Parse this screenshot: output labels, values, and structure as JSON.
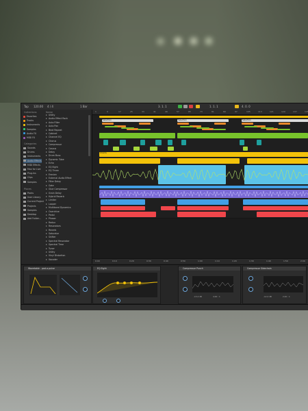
{
  "toolbar": {
    "tap_label": "Tap",
    "tempo": "120.00",
    "time_sig": "4 / 4",
    "bar_label": "1 Bar",
    "position": "3. 1. 1",
    "loop_start": "1. 1. 1",
    "loop_len": "4. 0. 0"
  },
  "browser": {
    "collections_header": "Collections",
    "names_header": "Name",
    "collections": [
      {
        "label": "Favorites",
        "color": "#e84b3c"
      },
      {
        "label": "Tracks",
        "color": "#f39c12"
      },
      {
        "label": "Instruments",
        "color": "#f1c40f"
      },
      {
        "label": "Samples",
        "color": "#2ecc71"
      },
      {
        "label": "Audio FX",
        "color": "#3498db"
      },
      {
        "label": "MIDI FX",
        "color": "#9b59b6"
      }
    ],
    "categories_header": "Categories",
    "categories": [
      "Sounds",
      "Drums",
      "Instruments",
      "Audio Effects",
      "MIDI Effects",
      "Max for Live",
      "Plug-Ins",
      "Clips",
      "Samples"
    ],
    "places_header": "Places",
    "places": [
      "Packs",
      "User Library",
      "Current Project",
      "Projects",
      "Samples",
      "Desktop",
      "Add Folder..."
    ],
    "names": [
      "Utility",
      "Audio Effect Rack",
      "Auto Filter",
      "Auto Pan",
      "Beat Repeat",
      "Cabinet",
      "Channel EQ",
      "Chorus",
      "Compressor",
      "Corpus",
      "Delay",
      "Drum Buss",
      "Dynamic Tube",
      "Echo",
      "EQ Eight",
      "EQ Three",
      "Erosion",
      "External Audio Effect",
      "Filter Delay",
      "Gate",
      "Glue Compressor",
      "Grain Delay",
      "Hybrid Reverb",
      "Limiter",
      "Looper",
      "Multiband Dynamics",
      "Overdrive",
      "Pedal",
      "Phaser",
      "Redux",
      "Resonators",
      "Reverb",
      "Saturator",
      "Shifter",
      "Spectral Resonator",
      "Spectral Time",
      "Tuner",
      "Utility",
      "Vinyl Distortion",
      "Vocoder"
    ]
  },
  "arrangement": {
    "ruler_marks": [
      "1",
      "9",
      "17",
      "25",
      "33",
      "41",
      "49",
      "57",
      "65",
      "73",
      "81",
      "89",
      "97",
      "105",
      "113",
      "121",
      "129",
      "137",
      "145"
    ],
    "time_marks": [
      "0:00",
      "0:10",
      "0:20",
      "0:30",
      "0:40",
      "0:50",
      "1:00",
      "1:10",
      "1:20",
      "1:30",
      "1:40",
      "1:50",
      "2:00"
    ],
    "group_label": "Selection",
    "clip_label": "Chords",
    "colors": {
      "yellow": "#f3c20a",
      "orange": "#e9892a",
      "green": "#78c32b",
      "teal": "#1e9f9d",
      "lightgreen": "#a6d63c",
      "blue": "#42a0e6",
      "cyan": "#5cc3e8",
      "red": "#f0464b",
      "purple": "#7b6bd6"
    }
  },
  "devices": {
    "items": [
      {
        "title": "Wavetable - pad-a-pulse",
        "color": "#f3c20a"
      },
      {
        "title": "EQ Eight",
        "color": "#f3c20a"
      },
      {
        "title": "Compressor Punch",
        "color": "#f3c20a"
      },
      {
        "title": "Compressor Sidechain",
        "color": "#f3c20a"
      }
    ],
    "labels": [
      "Release",
      "Threshold",
      "Ratio",
      "Attack",
      "Output",
      "Dry/Wet",
      "Gain",
      "Freq",
      "Q",
      "Makeup"
    ],
    "values": [
      "-13.4 dB",
      "4.00 : 1",
      "1.00 ms",
      "30.0 ms",
      "0.00 dB",
      "100 %",
      "-12.4 dB",
      "2.40 : 1"
    ]
  }
}
